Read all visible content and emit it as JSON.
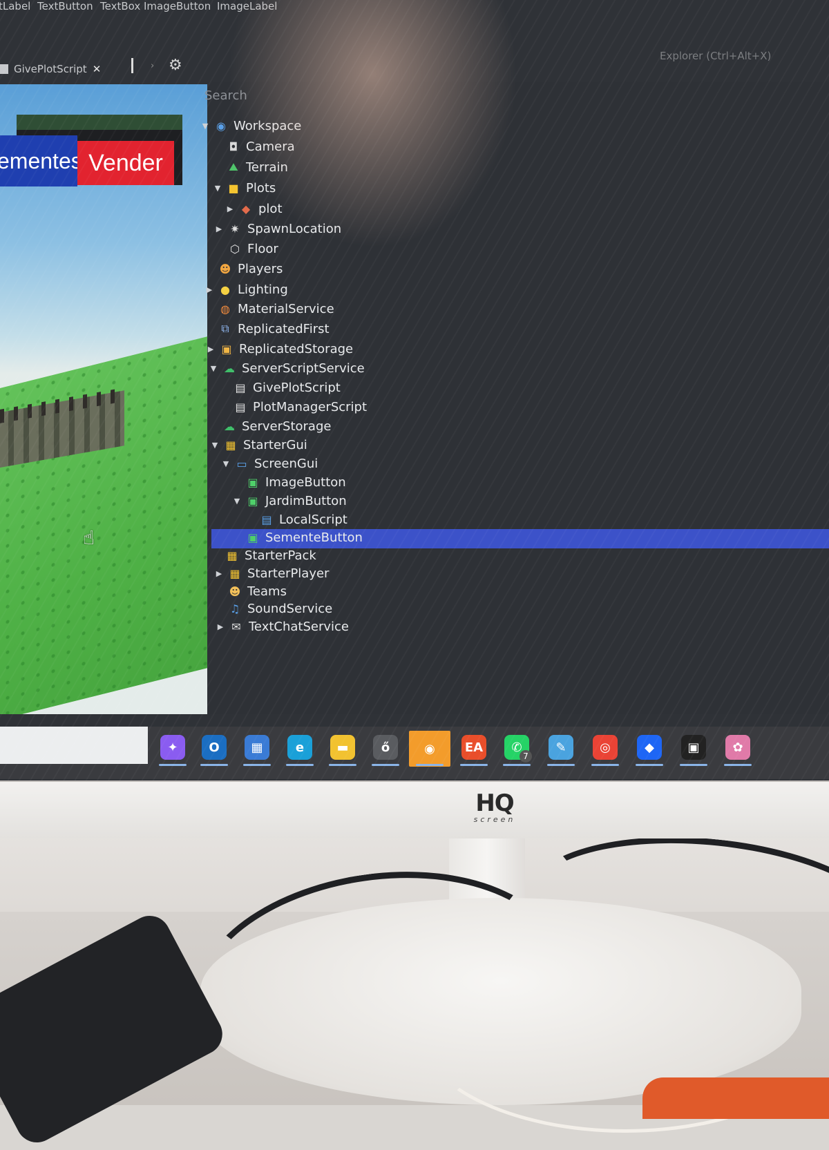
{
  "insert_toolbar": [
    "tLabel",
    "TextButton",
    "TextBox",
    "ImageButton",
    "ImageLabel"
  ],
  "tab": {
    "label": "GivePlotScript"
  },
  "explorer": {
    "title": "Explorer (Ctrl+Alt+X)",
    "search_placeholder": "Search"
  },
  "viewport": {
    "sementes_label": "ementes",
    "vender_label": "Vender"
  },
  "tree": [
    {
      "label": "Workspace",
      "icon": "workspace-icon",
      "expanded": true
    },
    {
      "label": "Camera",
      "icon": "camera-icon"
    },
    {
      "label": "Terrain",
      "icon": "terrain-icon"
    },
    {
      "label": "Plots",
      "icon": "folder-icon",
      "expanded": true
    },
    {
      "label": "plot",
      "icon": "model-icon",
      "expanded": false
    },
    {
      "label": "SpawnLocation",
      "icon": "spawn-icon",
      "expanded": false
    },
    {
      "label": "Floor",
      "icon": "part-icon"
    },
    {
      "label": "Players",
      "icon": "players-icon"
    },
    {
      "label": "Lighting",
      "icon": "lighting-icon",
      "expanded": false
    },
    {
      "label": "MaterialService",
      "icon": "material-icon"
    },
    {
      "label": "ReplicatedFirst",
      "icon": "replicated-first-icon"
    },
    {
      "label": "ReplicatedStorage",
      "icon": "replicated-storage-icon",
      "expanded": false
    },
    {
      "label": "ServerScriptService",
      "icon": "server-script-service-icon",
      "expanded": true
    },
    {
      "label": "GivePlotScript",
      "icon": "script-icon"
    },
    {
      "label": "PlotManagerScript",
      "icon": "script-icon"
    },
    {
      "label": "ServerStorage",
      "icon": "server-storage-icon"
    },
    {
      "label": "StarterGui",
      "icon": "starter-gui-icon",
      "expanded": true
    },
    {
      "label": "ScreenGui",
      "icon": "screen-gui-icon",
      "expanded": true
    },
    {
      "label": "ImageButton",
      "icon": "image-button-icon"
    },
    {
      "label": "JardimButton",
      "icon": "image-button-icon",
      "expanded": true
    },
    {
      "label": "LocalScript",
      "icon": "local-script-icon"
    },
    {
      "label": "SementeButton",
      "icon": "image-button-icon",
      "selected": true
    },
    {
      "label": "StarterPack",
      "icon": "starter-pack-icon"
    },
    {
      "label": "StarterPlayer",
      "icon": "starter-player-icon",
      "expanded": false
    },
    {
      "label": "Teams",
      "icon": "teams-icon"
    },
    {
      "label": "SoundService",
      "icon": "sound-service-icon"
    },
    {
      "label": "TextChatService",
      "icon": "text-chat-service-icon",
      "expanded": false
    }
  ],
  "taskbar": {
    "apps": [
      "copilot-icon",
      "outlook-icon",
      "store-icon",
      "edge-icon",
      "file-explorer-icon",
      "app-icon",
      "game-launcher-icon",
      "ea-icon",
      "whatsapp-icon",
      "paint-icon",
      "chrome-icon",
      "roblox-icon",
      "roblox-studio-icon",
      "studio-alt-icon"
    ],
    "whatsapp_badge": "7"
  },
  "monitor": {
    "brand": "HQ",
    "brand_sub": "screen"
  },
  "colors": {
    "selection": "#3c52c9",
    "sementes_button": "#1f3fb0",
    "vender_button": "#e2232f"
  }
}
